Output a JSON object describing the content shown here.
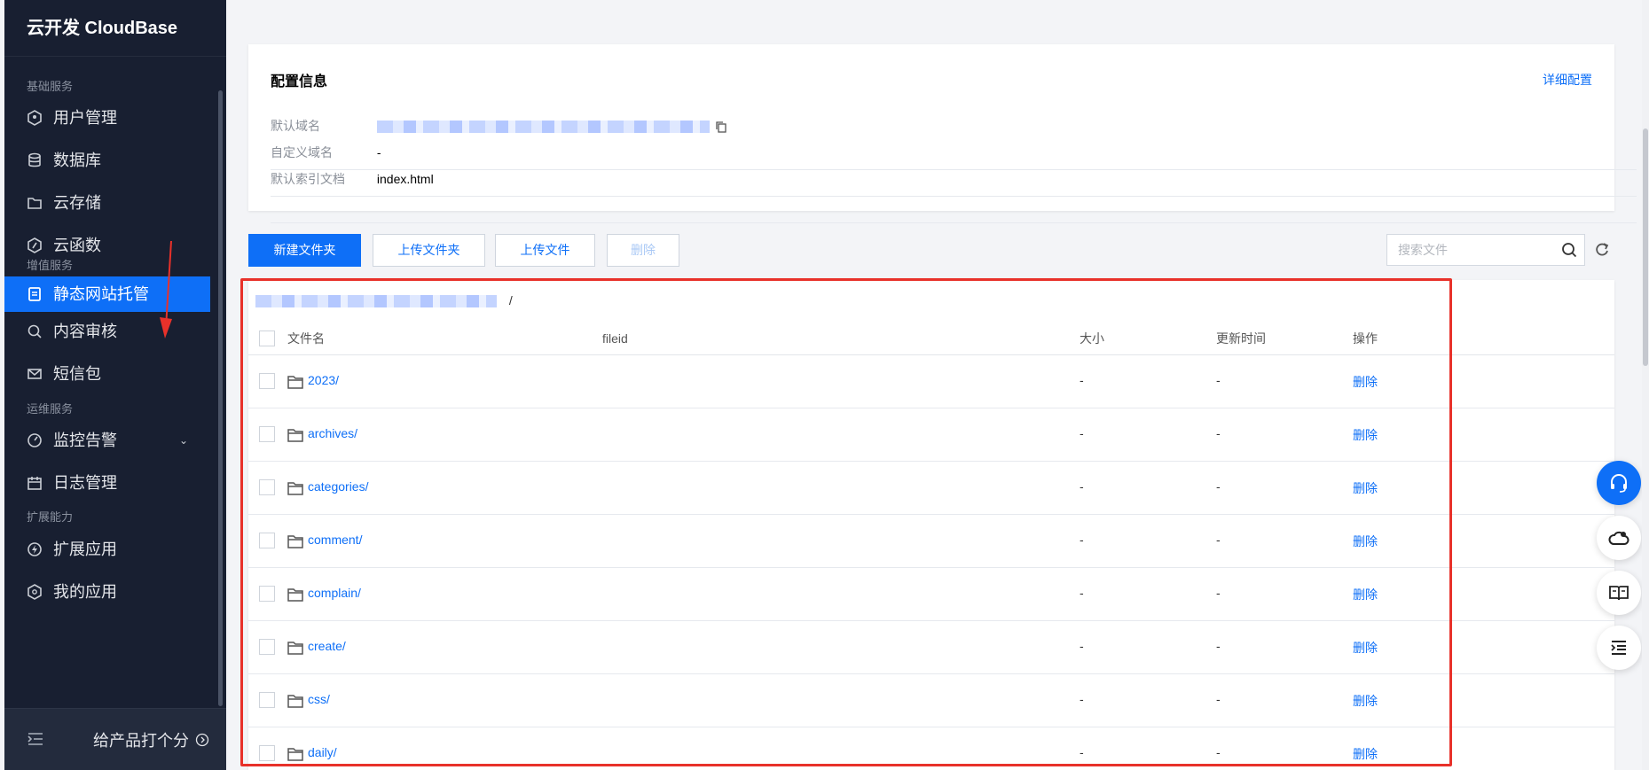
{
  "app": {
    "brand": "云开发 CloudBase"
  },
  "sidebar": {
    "groups": [
      {
        "title": "基础服务",
        "items": [
          {
            "label": "用户管理",
            "icon": "user-shield-icon"
          },
          {
            "label": "数据库",
            "icon": "database-icon"
          },
          {
            "label": "云存储",
            "icon": "folder-icon"
          },
          {
            "label": "云函数",
            "icon": "function-icon"
          }
        ]
      },
      {
        "title": "增值服务",
        "items": [
          {
            "label": "静态网站托管",
            "icon": "document-icon",
            "active": true
          },
          {
            "label": "内容审核",
            "icon": "search-icon"
          },
          {
            "label": "短信包",
            "icon": "mail-icon"
          }
        ]
      },
      {
        "title": "运维服务",
        "items": [
          {
            "label": "监控告警",
            "icon": "gauge-icon",
            "expandable": true
          },
          {
            "label": "日志管理",
            "icon": "calendar-icon"
          }
        ]
      },
      {
        "title": "扩展能力",
        "items": [
          {
            "label": "扩展应用",
            "icon": "bolt-icon"
          },
          {
            "label": "我的应用",
            "icon": "app-icon"
          }
        ]
      }
    ],
    "footer": {
      "rate_label": "给产品打个分"
    }
  },
  "config": {
    "title": "配置信息",
    "detail_link": "详细配置",
    "fields": [
      {
        "label": "默认域名",
        "value": ""
      },
      {
        "label": "自定义域名",
        "value": "-"
      },
      {
        "label": "默认索引文档",
        "value": "index.html"
      }
    ]
  },
  "toolbar": {
    "new_folder": "新建文件夹",
    "upload_folder": "上传文件夹",
    "upload_file": "上传文件",
    "delete": "删除",
    "search_placeholder": "搜索文件"
  },
  "table": {
    "breadcrumb_sep": "/",
    "columns": {
      "name": "文件名",
      "fileid": "fileid",
      "size": "大小",
      "time": "更新时间",
      "action": "操作"
    },
    "rows": [
      {
        "name": "2023/",
        "size": "-",
        "time": "-",
        "action": "删除"
      },
      {
        "name": "archives/",
        "size": "-",
        "time": "-",
        "action": "删除"
      },
      {
        "name": "categories/",
        "size": "-",
        "time": "-",
        "action": "删除"
      },
      {
        "name": "comment/",
        "size": "-",
        "time": "-",
        "action": "删除"
      },
      {
        "name": "complain/",
        "size": "-",
        "time": "-",
        "action": "删除"
      },
      {
        "name": "create/",
        "size": "-",
        "time": "-",
        "action": "删除"
      },
      {
        "name": "css/",
        "size": "-",
        "time": "-",
        "action": "删除"
      },
      {
        "name": "daily/",
        "size": "-",
        "time": "-",
        "action": "删除"
      }
    ]
  },
  "colors": {
    "accent": "#0e6ff7",
    "sidebar_bg": "#181f31",
    "highlight": "#e8312a"
  }
}
